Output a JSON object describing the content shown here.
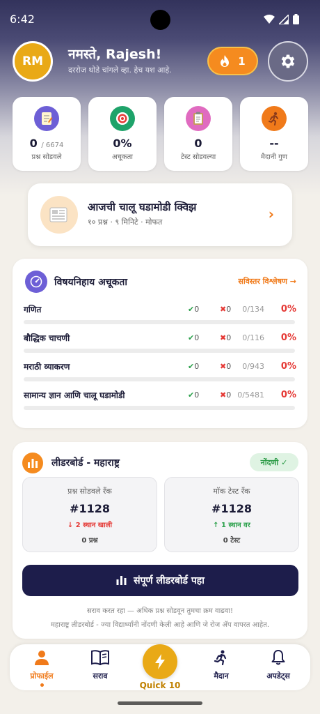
{
  "status_bar": {
    "time": "6:42"
  },
  "header": {
    "avatar_initials": "RM",
    "greeting": "नमस्ते, Rajesh!",
    "subtitle": "दररोज थोडे चांगले व्हा. हेच यश आहे.",
    "streak_count": "1",
    "streak_icon": "flame-icon",
    "settings_icon": "gear-icon"
  },
  "stats": [
    {
      "icon": "notepad-icon",
      "value": "0",
      "value_suffix": "/ 6674",
      "label": "प्रश्न सोडवले",
      "color": "#6d5fd6"
    },
    {
      "icon": "target-icon",
      "value": "0%",
      "value_suffix": "",
      "label": "अचूकता",
      "color": "#1ea36a"
    },
    {
      "icon": "clipboard-icon",
      "value": "0",
      "value_suffix": "",
      "label": "टेस्ट सोडवल्या",
      "color": "#e06bc0"
    },
    {
      "icon": "runner-icon",
      "value": "--",
      "value_suffix": "",
      "label": "मैदानी गुण",
      "color": "#f07a1a"
    }
  ],
  "quiz": {
    "title": "आजची चालू घडामोडी क्विझ",
    "subtitle": "१० प्रश्न · ९ मिनिटे · मोफत",
    "arrow": "›"
  },
  "accuracy": {
    "title": "विषयनिहाय अचूकता",
    "link": "सविस्तर विश्लेषण →",
    "subjects": [
      {
        "name": "गणित",
        "correct": "0",
        "wrong": "0",
        "total": "0/134",
        "pct": "0%",
        "progress": 0
      },
      {
        "name": "बौद्धिक चाचणी",
        "correct": "0",
        "wrong": "0",
        "total": "0/116",
        "pct": "0%",
        "progress": 0
      },
      {
        "name": "मराठी व्याकरण",
        "correct": "0",
        "wrong": "0",
        "total": "0/943",
        "pct": "0%",
        "progress": 0
      },
      {
        "name": "सामान्य ज्ञान आणि चालू घडामोडी",
        "correct": "0",
        "wrong": "0",
        "total": "0/5481",
        "pct": "0%",
        "progress": 0
      }
    ],
    "correct_mark": "✔",
    "wrong_mark": "✖"
  },
  "leaderboard": {
    "title": "लीडरबोर्ड - महाराष्ट्र",
    "badge": "नोंदणी ✓",
    "practice_rank": {
      "label": "प्रश्न सोडवले रँक",
      "rank": "#1128",
      "change": "↓ 2 स्थान खाली",
      "change_color": "#e53935",
      "count": "0 प्रश्न"
    },
    "mock_rank": {
      "label": "मॉक टेस्ट रँक",
      "rank": "#1128",
      "change": "↑ 1 स्थान वर",
      "change_color": "#2aa04a",
      "count": "0 टेस्ट"
    },
    "button_label": "संपूर्ण लीडरबोर्ड पहा",
    "note1": "सराव करत रहा — अधिक प्रश्न सोडवून तुमचा क्रम वाढवा!",
    "note2": "महाराष्ट्र लीडरबोर्ड - ज्या विद्यार्थ्यांनी नोंदणी केली आहे आणि जे रोज ॲप वापरत आहेत."
  },
  "nav": {
    "items": [
      {
        "label": "प्रोफाईल",
        "icon": "person-icon",
        "active": true
      },
      {
        "label": "सराव",
        "icon": "book-icon",
        "active": false
      },
      {
        "label": "Quick 10",
        "icon": "lightning-icon",
        "active": false
      },
      {
        "label": "मैदान",
        "icon": "runner-icon",
        "active": false
      },
      {
        "label": "अपडेट्स",
        "icon": "bell-icon",
        "active": false
      }
    ]
  }
}
